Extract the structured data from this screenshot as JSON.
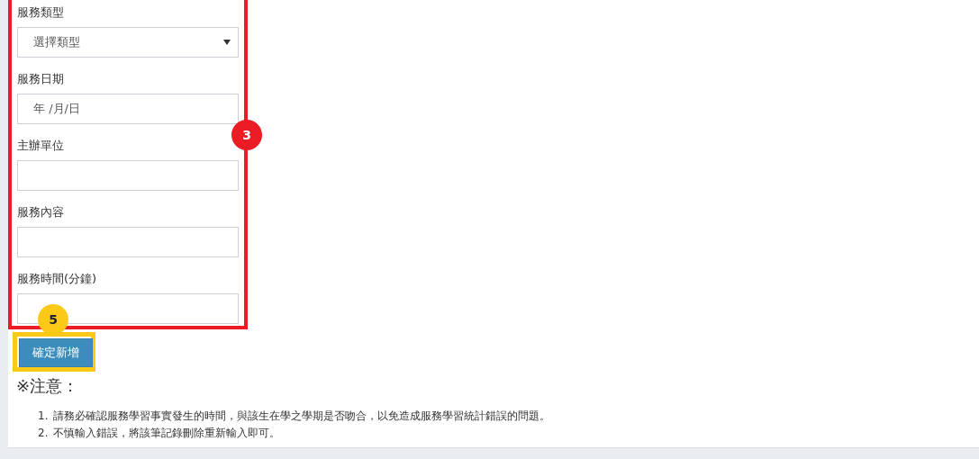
{
  "form": {
    "badge": "3",
    "fields": [
      {
        "kind": "select",
        "label": "服務類型",
        "value": "選擇類型"
      },
      {
        "kind": "date",
        "label": "服務日期",
        "value": "年 /月/日"
      },
      {
        "kind": "text",
        "label": "主辦單位"
      },
      {
        "kind": "text",
        "label": "服務內容"
      },
      {
        "kind": "text",
        "label": "服務時間(分鐘)"
      }
    ]
  },
  "submit": {
    "badge": "5",
    "label": "確定新增"
  },
  "notice": {
    "title": "※注意：",
    "items": [
      {
        "number": "1.",
        "text": "請務必確認服務學習事實發生的時間，與該生在學之學期是否吻合，以免造成服務學習統計錯誤的問題。"
      },
      {
        "number": "2.",
        "text": "不慎輸入錯誤，將該筆記錄刪除重新輸入即可。"
      }
    ]
  }
}
